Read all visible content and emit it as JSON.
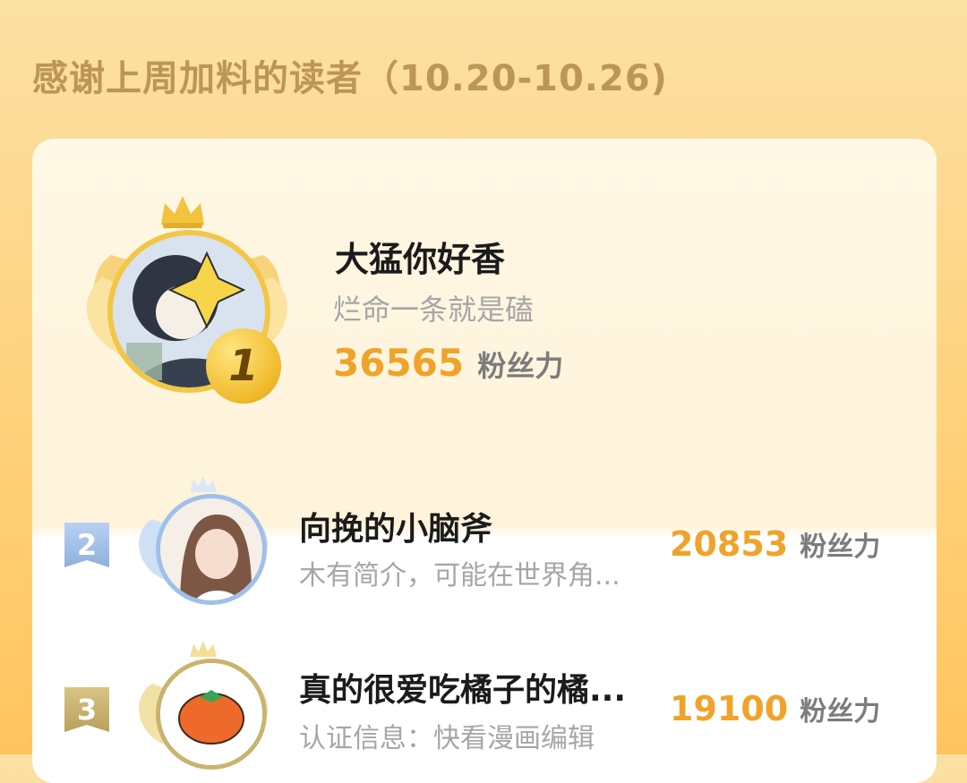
{
  "header": {
    "title": "感谢上周加料的读者（10.20-10.26)"
  },
  "top_reader": {
    "rank": "1",
    "name": "大猛你好香",
    "desc": "烂命一条就是磕",
    "score": "36565",
    "unit": "粉丝力"
  },
  "readers": [
    {
      "rank": "2",
      "name": "向挽的小脑斧",
      "desc": "木有简介，可能在世界角...",
      "score": "20853",
      "unit": "粉丝力"
    },
    {
      "rank": "3",
      "name": "真的很爱吃橘子的橘...",
      "desc": "认证信息：快看漫画编辑",
      "score": "19100",
      "unit": "粉丝力"
    }
  ],
  "icons": {
    "crown": "crown-icon",
    "wings": "wings-icon",
    "sparkle": "sparkle-icon",
    "tangerine": "tangerine-icon"
  },
  "colors": {
    "accent_orange": "#f0a32a",
    "header_text": "#bc9654",
    "gold": "#e9b32b",
    "silver_blue": "#a8c4ea",
    "bronze": "#c6b06d"
  }
}
